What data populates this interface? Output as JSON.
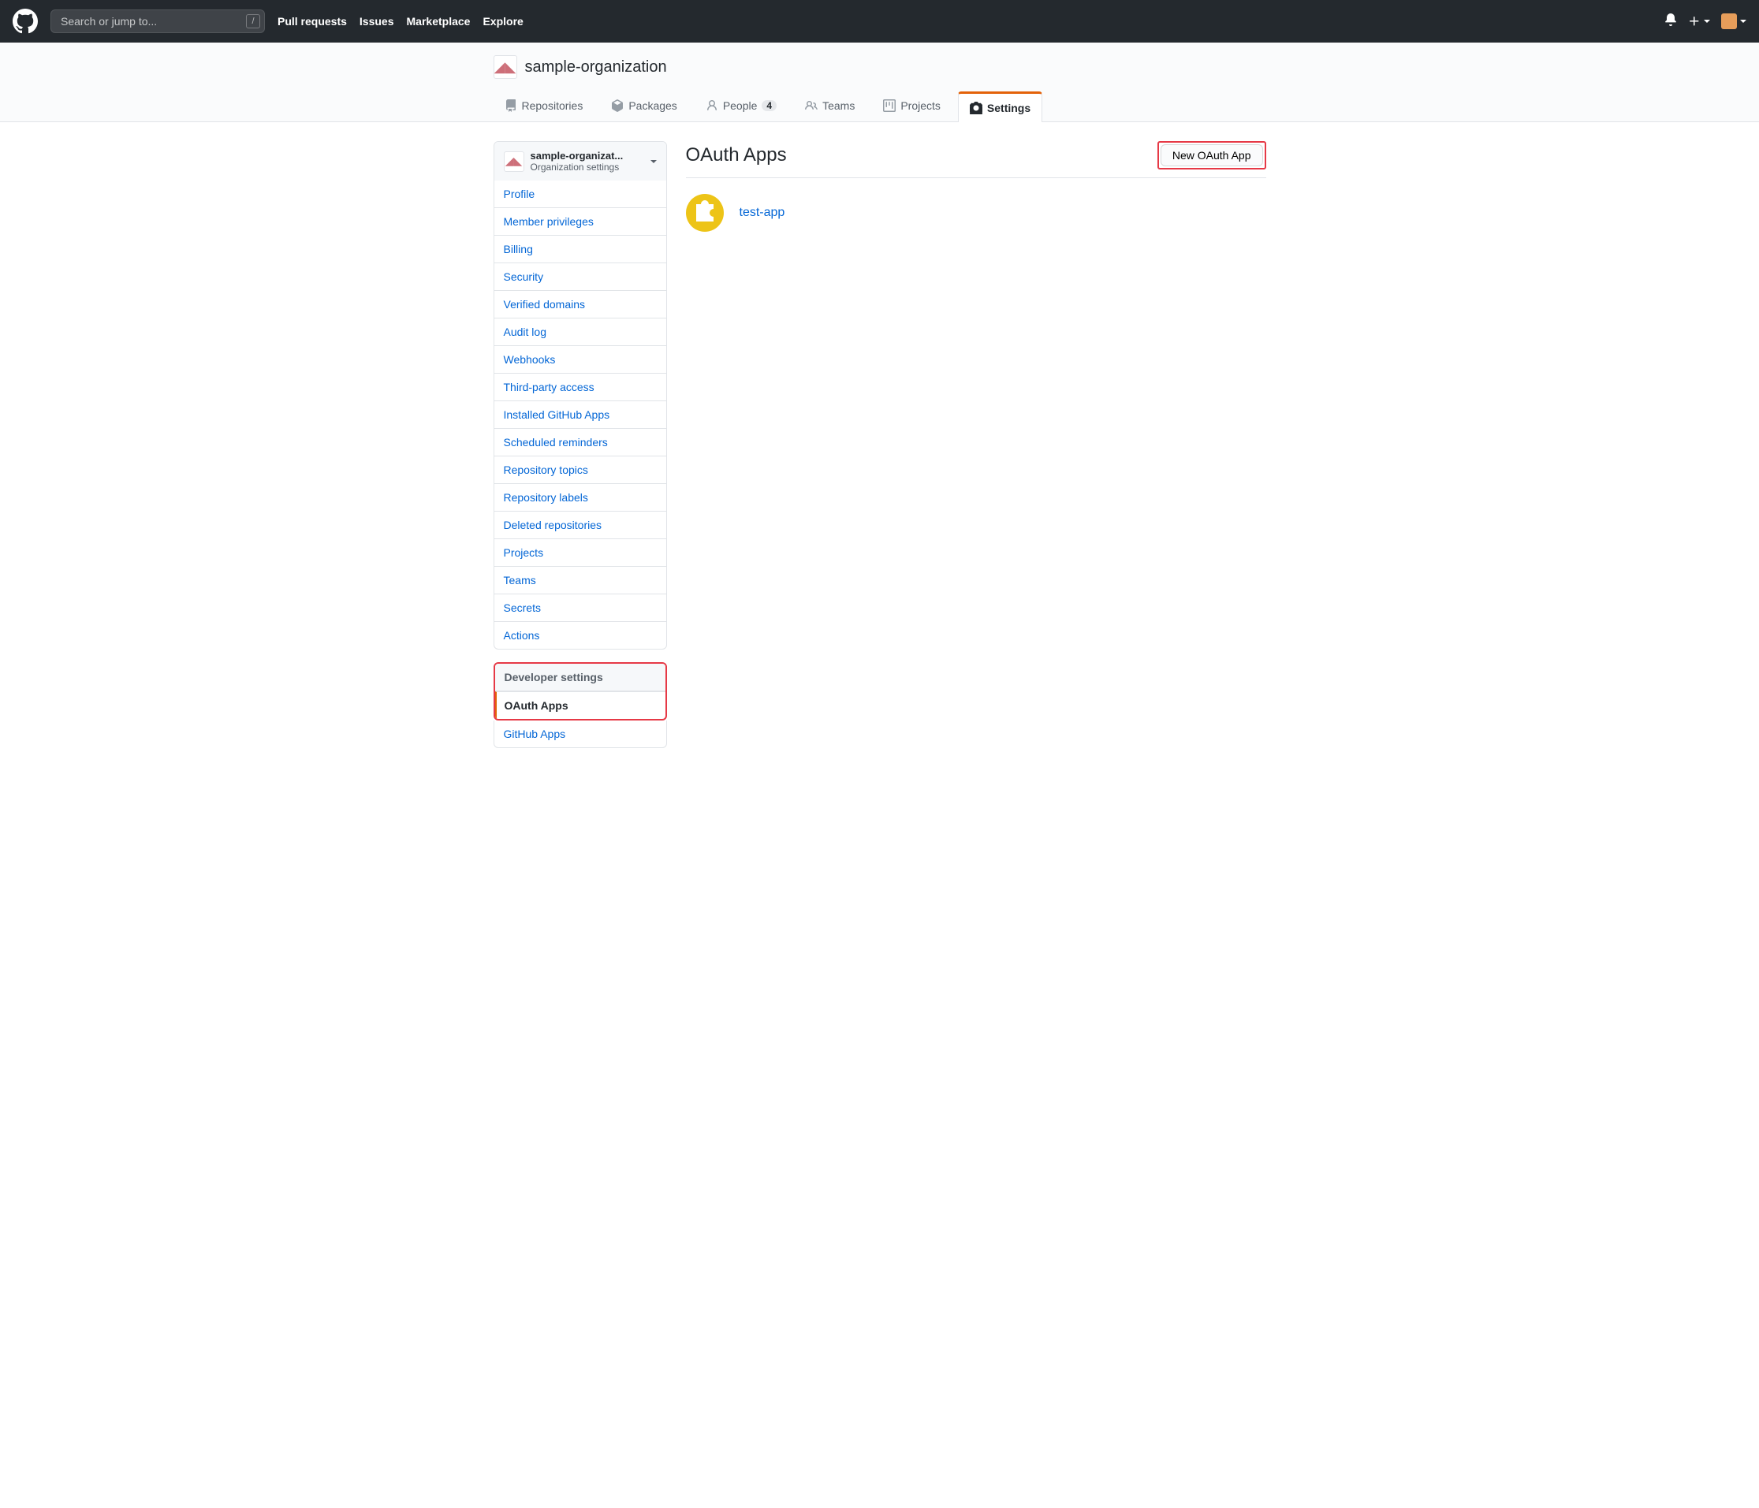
{
  "topbar": {
    "search_placeholder": "Search or jump to...",
    "search_key": "/",
    "nav": {
      "pull_requests": "Pull requests",
      "issues": "Issues",
      "marketplace": "Marketplace",
      "explore": "Explore"
    }
  },
  "org": {
    "name": "sample-organization"
  },
  "tabs": {
    "repositories": "Repositories",
    "packages": "Packages",
    "people": "People",
    "people_count": "4",
    "teams": "Teams",
    "projects": "Projects",
    "settings": "Settings"
  },
  "sidebar": {
    "header_name": "sample-organizat...",
    "header_sub": "Organization settings",
    "items": [
      {
        "label": "Profile"
      },
      {
        "label": "Member privileges"
      },
      {
        "label": "Billing"
      },
      {
        "label": "Security"
      },
      {
        "label": "Verified domains"
      },
      {
        "label": "Audit log"
      },
      {
        "label": "Webhooks"
      },
      {
        "label": "Third-party access"
      },
      {
        "label": "Installed GitHub Apps"
      },
      {
        "label": "Scheduled reminders"
      },
      {
        "label": "Repository topics"
      },
      {
        "label": "Repository labels"
      },
      {
        "label": "Deleted repositories"
      },
      {
        "label": "Projects"
      },
      {
        "label": "Teams"
      },
      {
        "label": "Secrets"
      },
      {
        "label": "Actions"
      }
    ],
    "dev_header": "Developer settings",
    "dev_items": {
      "oauth": "OAuth Apps",
      "github_apps": "GitHub Apps"
    }
  },
  "content": {
    "title": "OAuth Apps",
    "new_btn": "New OAuth App",
    "apps": [
      {
        "name": "test-app"
      }
    ]
  }
}
